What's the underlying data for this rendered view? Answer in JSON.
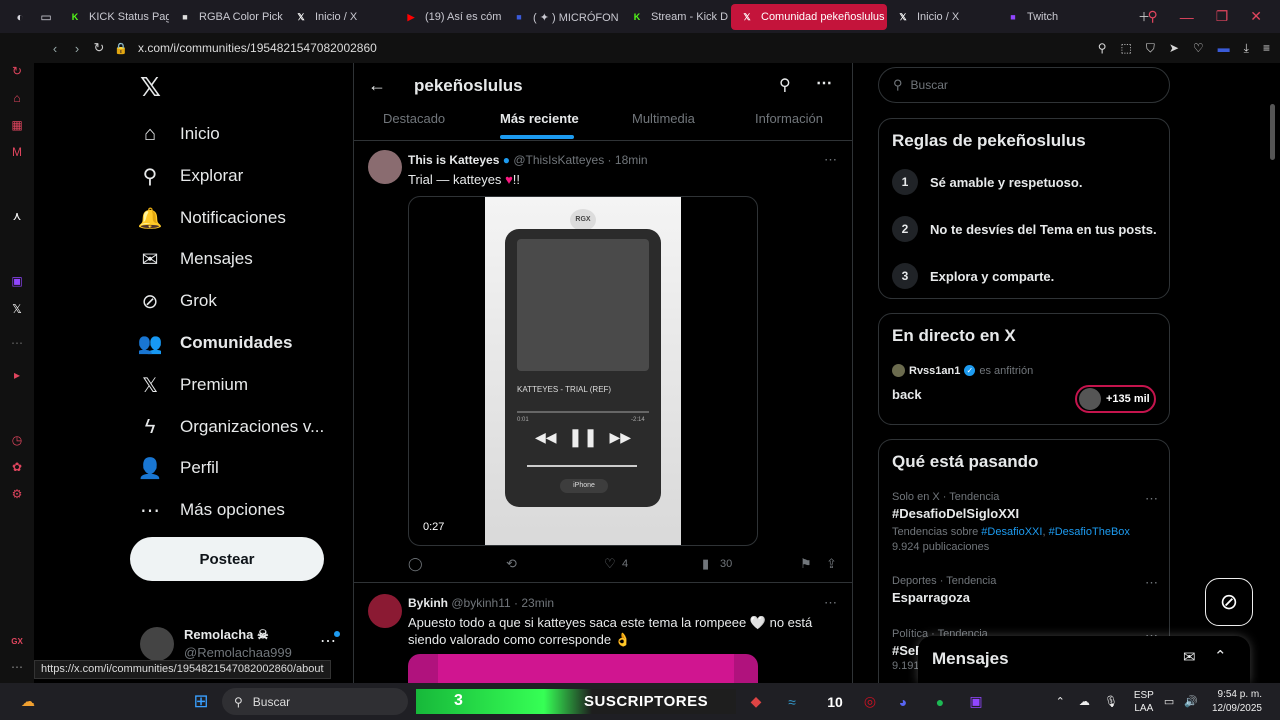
{
  "browser": {
    "tabs": [
      {
        "title": "KICK Status Pag",
        "icon": "kick-icon",
        "color": "#53fc18"
      },
      {
        "title": "RGBA Color Pick",
        "icon": "picker-icon",
        "color": "#dddddd"
      },
      {
        "title": "Inicio / X",
        "icon": "x-icon",
        "color": "#ffffff"
      },
      {
        "title": "(19) Así es cóm",
        "icon": "youtube-icon",
        "color": "#ff0000"
      },
      {
        "title": "( ✦ ) MICRÓFON",
        "icon": "app-icon",
        "color": "#3b5bdb"
      },
      {
        "title": "Stream - Kick D",
        "icon": "kick-icon",
        "color": "#53fc18"
      },
      {
        "title": "Comunidad pekeñoslulus",
        "icon": "x-icon",
        "color": "#ffffff",
        "active": true
      },
      {
        "title": "Inicio / X",
        "icon": "x-icon",
        "color": "#ffffff"
      },
      {
        "title": "Twitch",
        "icon": "twitch-icon",
        "color": "#9146ff"
      }
    ],
    "url": "x.com/i/communities/1954821547082002860",
    "status_url": "https://x.com/i/communities/1954821547082002860/about"
  },
  "nav": {
    "items": [
      {
        "label": "Inicio",
        "icon": "⌂"
      },
      {
        "label": "Explorar",
        "icon": "⚲"
      },
      {
        "label": "Notificaciones",
        "icon": "🔔"
      },
      {
        "label": "Mensajes",
        "icon": "✉"
      },
      {
        "label": "Grok",
        "icon": "⊘"
      },
      {
        "label": "Comunidades",
        "icon": "👥"
      },
      {
        "label": "Premium",
        "icon": "𝕏"
      },
      {
        "label": "Organizaciones v...",
        "icon": "ϟ"
      },
      {
        "label": "Perfil",
        "icon": "👤"
      },
      {
        "label": "Más opciones",
        "icon": "⋯"
      }
    ],
    "post_button": "Postear",
    "profile": {
      "name": "Remolacha ☠",
      "handle": "@Remolachaa999"
    }
  },
  "community": {
    "title": "pekeñoslulus",
    "tabs": [
      "Destacado",
      "Más reciente",
      "Multimedia",
      "Información"
    ]
  },
  "tweets": [
    {
      "name": "This is Katteyes",
      "handle": "@ThisIsKatteyes",
      "time": "18min",
      "text": "Trial — katteyes",
      "text_suffix": "!!",
      "media": {
        "badge": "RGX",
        "song": "KATTEYES - TRIAL (REF)",
        "elapsed": "0:01",
        "remaining": "-2:14",
        "device": "iPhone",
        "duration": "0:27"
      },
      "likes": "4",
      "views": "30"
    },
    {
      "name": "Bykinh",
      "handle": "@bykinh11",
      "time": "23min",
      "text": "Apuesto todo a que si katteyes saca este tema la rompeee 🤍 no está siendo valorado como corresponde 👌"
    }
  ],
  "right": {
    "search_placeholder": "Buscar",
    "rules_title": "Reglas de pekeñoslulus",
    "rules": [
      {
        "n": "1",
        "text": "Sé amable y respetuoso."
      },
      {
        "n": "2",
        "text": "No te desvíes del Tema en tus posts."
      },
      {
        "n": "3",
        "text": "Explora y comparte."
      }
    ],
    "live_title": "En directo en X",
    "live": {
      "host": "Rvss1an1",
      "role": "es anfitrión",
      "stream_title": "back",
      "listeners": "+135 mil"
    },
    "trending_title": "Qué está pasando",
    "trends": [
      {
        "category": "Solo en X · Tendencia",
        "title": "#DesafioDelSigloXXI",
        "sub_prefix": "Tendencias sobre",
        "sub_link1": "#DesafioXXI",
        "sub_link2": "#DesafioTheBox",
        "count": "9.924 publicaciones"
      },
      {
        "category": "Deportes · Tendencia",
        "title": "Esparragoza"
      },
      {
        "category": "Política · Tendencia",
        "title": "#SeR",
        "count": "9.191"
      }
    ]
  },
  "messages_title": "Mensajes",
  "taskbar": {
    "search_label": "Buscar",
    "banner_number": "3",
    "banner_text": "SUSCRIPTORES",
    "badge_number": "10",
    "lang_line1": "ESP",
    "lang_line2": "LAA",
    "time": "9:54 p. m.",
    "date": "12/09/2025"
  }
}
